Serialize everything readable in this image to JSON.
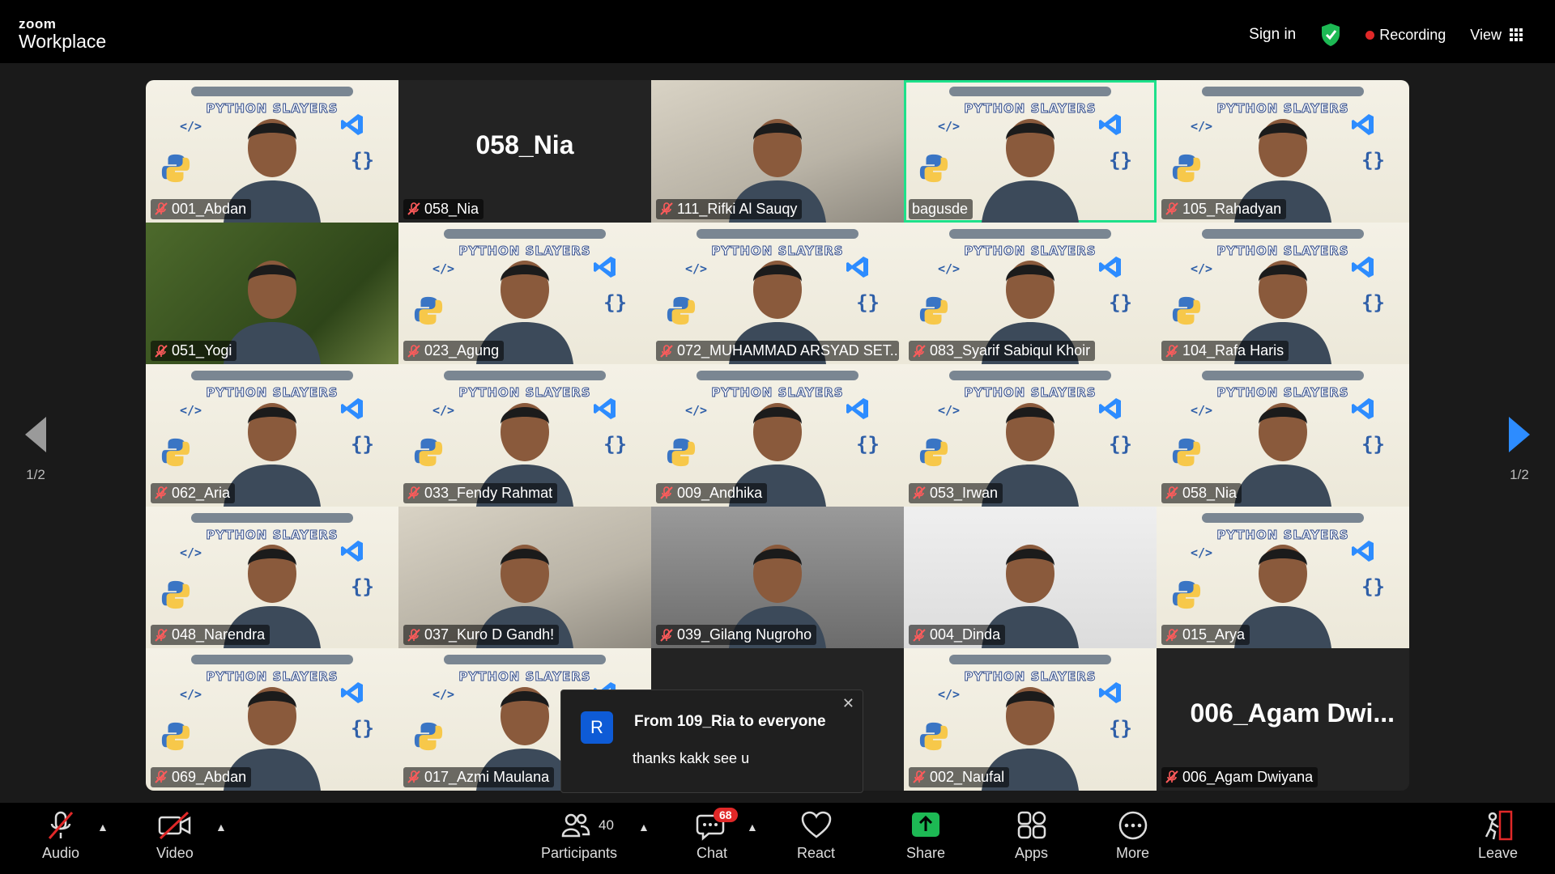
{
  "brand": {
    "line1": "zoom",
    "line2": "Workplace"
  },
  "top": {
    "sign_in": "Sign in",
    "recording": "Recording",
    "view": "View"
  },
  "colors": {
    "accent_green": "#1ee08a",
    "record_red": "#e02828",
    "share_green": "#1db954"
  },
  "tiles": [
    {
      "name": "001_Abdan",
      "muted": true,
      "bg": "slide"
    },
    {
      "name": "058_Nia",
      "muted": true,
      "bg": "dark",
      "big_name": "058_Nia"
    },
    {
      "name": "111_Rifki Al Sauqy",
      "muted": true,
      "bg": "room"
    },
    {
      "name": "bagusde",
      "muted": false,
      "bg": "slide",
      "active": true
    },
    {
      "name": "105_Rahadyan",
      "muted": true,
      "bg": "slide"
    },
    {
      "name": "051_Yogi",
      "muted": true,
      "bg": "green"
    },
    {
      "name": "023_Agung",
      "muted": true,
      "bg": "slide"
    },
    {
      "name": "072_MUHAMMAD ARSYAD SET...",
      "muted": true,
      "bg": "slide"
    },
    {
      "name": "083_Syarif Sabiqul Khoir",
      "muted": true,
      "bg": "slide"
    },
    {
      "name": "104_Rafa Haris",
      "muted": true,
      "bg": "slide"
    },
    {
      "name": "062_Aria",
      "muted": true,
      "bg": "slide"
    },
    {
      "name": "033_Fendy Rahmat",
      "muted": true,
      "bg": "slide"
    },
    {
      "name": "009_Andhika",
      "muted": true,
      "bg": "slide"
    },
    {
      "name": "053_Irwan",
      "muted": true,
      "bg": "slide"
    },
    {
      "name": "058_Nia",
      "muted": true,
      "bg": "slide"
    },
    {
      "name": "048_Narendra",
      "muted": true,
      "bg": "slide"
    },
    {
      "name": "037_Kuro D Gandh!",
      "muted": true,
      "bg": "room"
    },
    {
      "name": "039_Gilang Nugroho",
      "muted": true,
      "bg": "gray"
    },
    {
      "name": "004_Dinda",
      "muted": true,
      "bg": "white"
    },
    {
      "name": "015_Arya",
      "muted": true,
      "bg": "slide"
    },
    {
      "name": "069_Abdan",
      "muted": true,
      "bg": "slide"
    },
    {
      "name": "017_Azmi Maulana",
      "muted": true,
      "bg": "slide"
    },
    {
      "name": "",
      "muted": false,
      "bg": "dark"
    },
    {
      "name": "002_Naufal",
      "muted": true,
      "bg": "slide"
    },
    {
      "name": "006_Agam Dwiyana",
      "muted": true,
      "bg": "dark",
      "big_name": "006_Agam  Dwi..."
    }
  ],
  "slide_text": {
    "title": "PYTHON SLAYERS"
  },
  "pager": {
    "left": "1/2",
    "right": "1/2"
  },
  "chat_popup": {
    "avatar": "R",
    "from": "From 109_Ria to everyone",
    "message": "thanks kakk see u"
  },
  "toolbar": {
    "audio": "Audio",
    "video": "Video",
    "participants": "Participants",
    "participants_count": "40",
    "chat": "Chat",
    "chat_badge": "68",
    "react": "React",
    "share": "Share",
    "apps": "Apps",
    "more": "More",
    "leave": "Leave"
  }
}
